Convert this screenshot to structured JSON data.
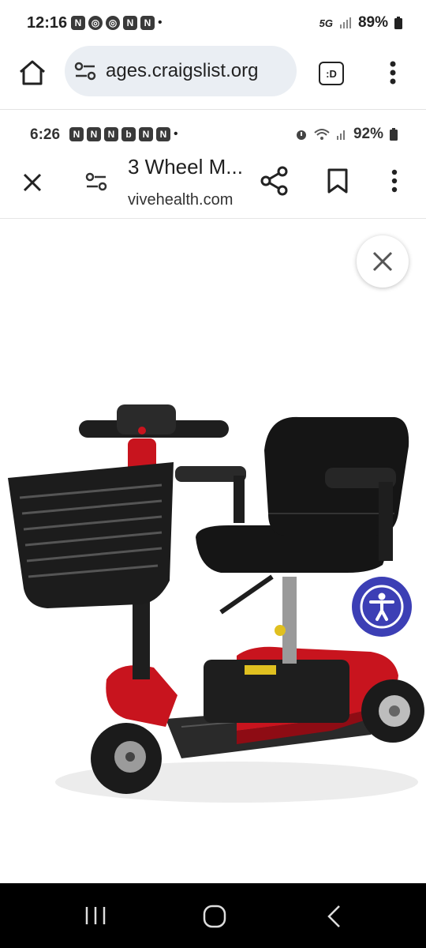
{
  "status_bar": {
    "time": "12:16",
    "network": "5G",
    "battery": "89%"
  },
  "browser": {
    "url": "ages.craigslist.org",
    "tabs_label": ":D"
  },
  "inner_status": {
    "time": "6:26",
    "battery": "92%"
  },
  "viewer": {
    "title": "3 Wheel M...",
    "domain": "vivehealth.com"
  },
  "icons": {
    "home": "home-icon",
    "tune": "page-info-icon",
    "menu": "more-vert-icon",
    "close": "close-icon",
    "share": "share-icon",
    "bookmark": "bookmark-icon",
    "accessibility": "accessibility-icon"
  },
  "colors": {
    "accessibility_button": "#3c3fb5",
    "scooter_red": "#c8141e"
  }
}
